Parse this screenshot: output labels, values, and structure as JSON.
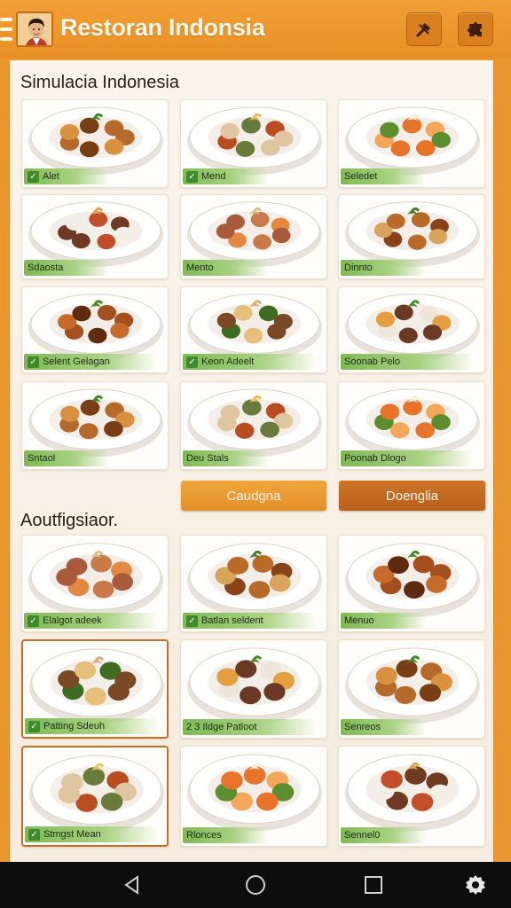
{
  "header": {
    "title": "Restoran Indonsia",
    "avatar_icon": "chef-avatar-icon",
    "action_buttons": [
      {
        "icon": "tools-icon"
      },
      {
        "icon": "puzzle-icon"
      }
    ]
  },
  "section1": {
    "title": "Simulacia Indonesia",
    "cards": [
      {
        "label": "Alet",
        "checked": true
      },
      {
        "label": "Mend",
        "checked": true
      },
      {
        "label": "Seledet",
        "checked": false
      },
      {
        "label": "Sdaosta",
        "checked": false
      },
      {
        "label": "Mento",
        "checked": false
      },
      {
        "label": "Dinnto",
        "checked": false
      },
      {
        "label": "Selent Gelagan",
        "checked": true
      },
      {
        "label": "Keon Adeelt",
        "checked": true
      },
      {
        "label": "Soonab Pelo",
        "checked": false
      },
      {
        "label": "Sntaol",
        "checked": false
      },
      {
        "label": "Deu Stals",
        "checked": false
      },
      {
        "label": "Poonab Dlogo",
        "checked": false
      }
    ],
    "buttons": [
      {
        "label": "Caudgna",
        "style": "light"
      },
      {
        "label": "Doenglia",
        "style": "dark"
      }
    ]
  },
  "section2": {
    "title": "Aoutfigsiaor.",
    "cards": [
      {
        "label": "Elalgot adeek",
        "checked": true
      },
      {
        "label": "Batlan seldent",
        "checked": true
      },
      {
        "label": "Menuo",
        "checked": false
      },
      {
        "label": "Patting Sdeuh",
        "checked": true
      },
      {
        "label": "2 3 Ildge Patloot",
        "checked": false
      },
      {
        "label": "Senreos",
        "checked": false
      },
      {
        "label": "Stmgst Mean",
        "checked": true
      },
      {
        "label": "Rlonces",
        "checked": false
      },
      {
        "label": "Sennel0",
        "checked": false
      }
    ]
  },
  "navbar": {
    "items": [
      {
        "icon": "back-triangle-icon"
      },
      {
        "icon": "home-circle-icon"
      },
      {
        "icon": "recents-square-icon"
      },
      {
        "icon": "settings-gear-icon"
      }
    ]
  },
  "colors": {
    "header": "#e88f25",
    "label_green": "#7fb955",
    "button_light": "#e4902a",
    "button_dark": "#b9601c"
  }
}
